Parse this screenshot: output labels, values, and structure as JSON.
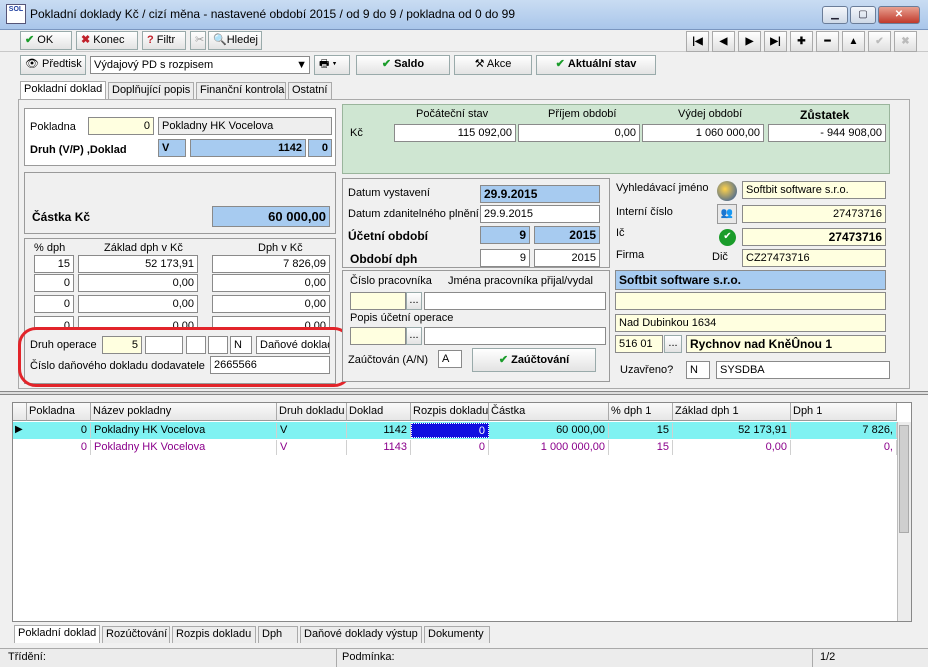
{
  "window": {
    "title": "Pokladní doklady Kč / cizí měna - nastavené období 2015 / od 9 do 9 / pokladna od 0 do 99",
    "logo_text": "SOL"
  },
  "toolbar": {
    "ok": "OK",
    "konec": "Konec",
    "filtr": "Filtr",
    "hledej": "Hledej"
  },
  "toolbar2": {
    "predtisk": "Předtisk",
    "report": "Výdajový PD s rozpisem",
    "saldo": "Saldo",
    "akce": "Akce",
    "aktualni_stav": "Aktuální stav"
  },
  "tabs": [
    "Pokladní doklad",
    "Doplňující popis",
    "Finanční kontrola",
    "Ostatní"
  ],
  "left": {
    "pokladna_label": "Pokladna",
    "pokladna_num": "0",
    "pokladna_name": "Pokladny HK Vocelova",
    "druh_label": "Druh (V/P) ,Doklad",
    "druh": "V",
    "doklad": "1142",
    "doklad2": "0",
    "castka_label": "Částka Kč",
    "castka": "60 000,00"
  },
  "dph": {
    "h1": "% dph",
    "h2": "Základ dph v Kč",
    "h3": "Dph v Kč",
    "rows": [
      {
        "p": "15",
        "z": "52 173,91",
        "d": "7 826,09"
      },
      {
        "p": "0",
        "z": "0,00",
        "d": "0,00"
      },
      {
        "p": "0",
        "z": "0,00",
        "d": "0,00"
      },
      {
        "p": "0",
        "z": "0,00",
        "d": "0,00"
      }
    ]
  },
  "druh_operace": {
    "label": "Druh operace",
    "v1": "5",
    "v2": "",
    "v3": "",
    "v4": "",
    "v5": "N",
    "text": "Daňové doklad",
    "cislo_label": "Číslo daňového dokladu dodavatele",
    "cislo": "2665566"
  },
  "saldo": {
    "h_pocatecni": "Počáteční stav",
    "h_prijem": "Příjem období",
    "h_vydej": "Výdej období",
    "h_zustatek": "Zůstatek",
    "kc": "Kč",
    "pocatecni": "115 092,00",
    "prijem": "0,00",
    "vydej": "1 060 000,00",
    "zustatek": "- 944 908,00"
  },
  "datum": {
    "vystaveni_label": "Datum vystavení",
    "vystaveni": "29.9.2015",
    "zdan_label": "Datum zdanitelného plnění",
    "zdan": "29.9.2015",
    "ucetni_label": "Účetní období",
    "ucetni_m": "9",
    "ucetni_r": "2015",
    "obdobi_label": "Období dph",
    "obdobi_m": "9",
    "obdobi_r": "2015"
  },
  "pracovnik": {
    "cislo_label": "Číslo pracovníka",
    "jmena_label": "Jména pracovníka přijal/vydal",
    "popis_label": "Popis účetní operace",
    "zauct_label": "Zaúčtován (A/N)",
    "zauct_val": "A",
    "zauct_btn": "Zaúčtování",
    "dots": "..."
  },
  "partner": {
    "vyhl_label": "Vyhledávací jméno",
    "vyhl": "Softbit software s.r.o.",
    "interni_label": "Interní číslo",
    "interni": "27473716",
    "ic_label": "Ič",
    "ic": "27473716",
    "firma_label": "Firma",
    "dic_label": "Dič",
    "dic": "CZ27473716",
    "name": "Softbit software s.r.o.",
    "addr1": "",
    "street": "Nad Dubinkou 1634",
    "psc": "516 01",
    "city": "Rychnov nad KněÛnou 1",
    "uzavreno_label": "Uzavřeno?",
    "uzavreno": "N",
    "user": "SYSDBA"
  },
  "grid": {
    "headers": [
      "Pokladna",
      "Název pokladny",
      "Druh dokladu",
      "Doklad",
      "Rozpis dokladu",
      "Částka",
      "% dph 1",
      "Základ dph 1",
      "Dph 1"
    ],
    "rows": [
      [
        "0",
        "Pokladny HK Vocelova",
        "V",
        "1142",
        "0",
        "60 000,00",
        "15",
        "52 173,91",
        "7 826,"
      ],
      [
        "0",
        "Pokladny HK Vocelova",
        "V",
        "1143",
        "0",
        "1 000 000,00",
        "15",
        "0,00",
        "0,"
      ]
    ]
  },
  "bottom_tabs": [
    "Pokladní doklad",
    "Rozúčtování",
    "Rozpis dokladu",
    "Dph",
    "Daňové doklady výstup",
    "Dokumenty"
  ],
  "status": {
    "trideni": "Třídění:",
    "podminka": "Podmínka:",
    "page": "1/2"
  }
}
